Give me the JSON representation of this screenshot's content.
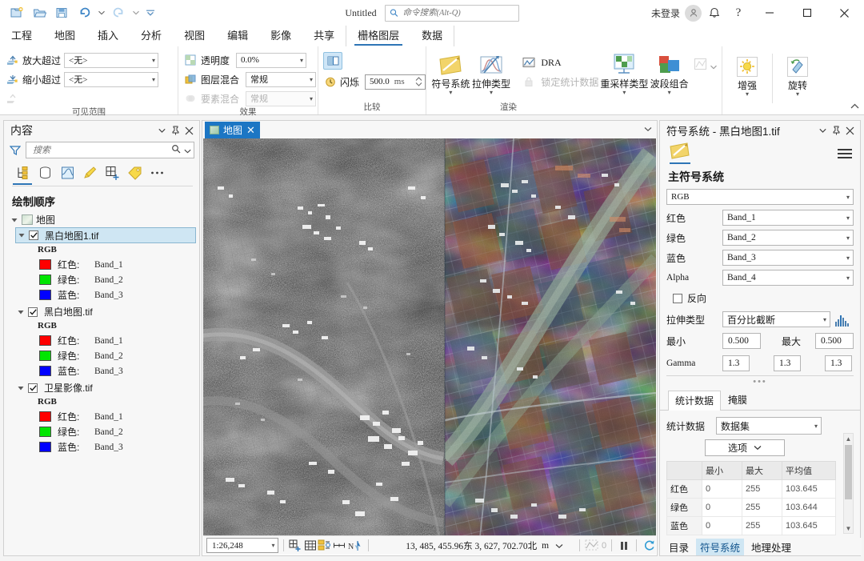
{
  "titlebar": {
    "doc_title": "Untitled",
    "search_placeholder": "命令搜索(Alt-Q)",
    "signin_label": "未登录",
    "qat": [
      {
        "name": "new-project-icon",
        "label": "新建工程"
      },
      {
        "name": "open-project-icon",
        "label": "打开工程"
      },
      {
        "name": "save-project-icon",
        "label": "保存工程"
      },
      {
        "name": "undo-icon",
        "label": "撤销"
      },
      {
        "name": "redo-icon",
        "label": "重做"
      },
      {
        "name": "customize-qat-icon",
        "label": "自定义快速访问工具栏"
      }
    ],
    "window_controls": [
      "minimize",
      "maximize",
      "close"
    ],
    "help_label": "?"
  },
  "ribbon_tabs": {
    "items": [
      "工程",
      "地图",
      "插入",
      "分析",
      "视图",
      "编辑",
      "影像",
      "共享"
    ],
    "contextual": [
      "栅格图层",
      "数据"
    ],
    "active": "栅格图层"
  },
  "ribbon": {
    "groups": [
      {
        "title": "可见范围",
        "rows": [
          {
            "label": "放大超过",
            "icon": "zoom-in-beyond-icon",
            "value": "<无>"
          },
          {
            "label": "缩小超过",
            "icon": "zoom-out-beyond-icon",
            "value": "<无>"
          },
          {
            "label": "",
            "icon": "visible-range-disabled-icon",
            "value": ""
          }
        ]
      },
      {
        "title": "效果",
        "rows": [
          {
            "label": "透明度",
            "icon": "transparency-icon",
            "value": "0.0%"
          },
          {
            "label": "图层混合",
            "icon": "layer-blend-icon",
            "value": "常规"
          },
          {
            "label": "要素混合",
            "icon": "feature-blend-icon",
            "value": "常规",
            "disabled": true
          }
        ]
      },
      {
        "title": "比较",
        "swipe_icon": "swipe-icon",
        "flicker_icon": "flicker-clock-icon",
        "flicker_label": "闪烁",
        "flicker_value": "500.0",
        "flicker_unit": "ms"
      },
      {
        "title": "渲染",
        "buttons": [
          {
            "label": "符号系统",
            "icon": "symbology-icon",
            "dropdown": true
          },
          {
            "label": "拉伸类型",
            "icon": "stretch-type-icon",
            "dropdown": true
          }
        ],
        "small_items": [
          {
            "label": "DRA",
            "icon": "dra-icon",
            "disabled": false
          },
          {
            "label": "锁定统计数据",
            "icon": "lock-statistics-icon",
            "disabled": true
          }
        ],
        "buttons2": [
          {
            "label": "重采样类型",
            "icon": "resample-type-icon",
            "dropdown": true
          },
          {
            "label": "波段组合",
            "icon": "band-combination-icon",
            "dropdown": true
          }
        ],
        "extra_icon": {
          "label": "",
          "icon": "raster-function-icon",
          "disabled": true,
          "dropdown": true
        }
      },
      {
        "title": "",
        "buttons": [
          {
            "label": "增强",
            "icon": "enhance-sun-icon",
            "dropdown": true
          },
          {
            "label": "旋转",
            "icon": "rotate-icon",
            "dropdown": true
          }
        ]
      }
    ],
    "collapse_icon": "chevron-up-icon"
  },
  "contents": {
    "title": "内容",
    "search_placeholder": "搜索",
    "tools": [
      {
        "name": "list-by-drawing-order-icon",
        "selected": true
      },
      {
        "name": "list-by-data-source-icon",
        "selected": false
      },
      {
        "name": "list-by-selection-icon",
        "selected": false
      },
      {
        "name": "list-by-editing-icon",
        "selected": false
      },
      {
        "name": "list-by-snapping-icon",
        "selected": false
      },
      {
        "name": "list-by-labeling-icon",
        "selected": false
      },
      {
        "name": "more-options-icon",
        "selected": false
      }
    ],
    "section_title": "绘制顺序",
    "map_node": "地图",
    "layers": [
      {
        "name": "黑白地图1.tif",
        "checked": true,
        "selected": true,
        "rgb_label": "RGB",
        "bands": [
          {
            "channel": "红色:",
            "band": "Band_1",
            "color": "#ff0000"
          },
          {
            "channel": "绿色:",
            "band": "Band_2",
            "color": "#00e500"
          },
          {
            "channel": "蓝色:",
            "band": "Band_3",
            "color": "#0000ff"
          }
        ]
      },
      {
        "name": "黑白地图.tif",
        "checked": true,
        "selected": false,
        "rgb_label": "RGB",
        "bands": [
          {
            "channel": "红色:",
            "band": "Band_1",
            "color": "#ff0000"
          },
          {
            "channel": "绿色:",
            "band": "Band_2",
            "color": "#00e500"
          },
          {
            "channel": "蓝色:",
            "band": "Band_3",
            "color": "#0000ff"
          }
        ]
      },
      {
        "name": "卫星影像.tif",
        "checked": true,
        "selected": false,
        "rgb_label": "RGB",
        "bands": [
          {
            "channel": "红色:",
            "band": "Band_1",
            "color": "#ff0000"
          },
          {
            "channel": "绿色:",
            "band": "Band_2",
            "color": "#00e500"
          },
          {
            "channel": "蓝色:",
            "band": "Band_3",
            "color": "#0000ff"
          }
        ]
      }
    ]
  },
  "mapview": {
    "tab_label": "地图",
    "status": {
      "scale": "1:26,248",
      "coords": "13, 485, 455.96东  3, 627, 702.70北",
      "unit": "m",
      "selection_count": "0"
    }
  },
  "symbology": {
    "title": "符号系统 - 黑白地图1.tif",
    "section_title": "主符号系统",
    "primary_value": "RGB",
    "channels": [
      {
        "label": "红色",
        "value": "Band_1"
      },
      {
        "label": "绿色",
        "value": "Band_2"
      },
      {
        "label": "蓝色",
        "value": "Band_3"
      },
      {
        "label": "Alpha",
        "value": "Band_4"
      }
    ],
    "invert_label": "反向",
    "invert_checked": false,
    "stretch_label": "拉伸类型",
    "stretch_value": "百分比截断",
    "min_label": "最小",
    "min_value": "0.500",
    "max_label": "最大",
    "max_value": "0.500",
    "gamma_label": "Gamma",
    "gamma_values": [
      "1.3",
      "1.3",
      "1.3"
    ],
    "tabs": [
      {
        "label": "统计数据",
        "active": true
      },
      {
        "label": "掩膜",
        "active": false
      }
    ],
    "stats_label": "统计数据",
    "stats_source": "数据集",
    "options_label": "选项",
    "table": {
      "headers": [
        "",
        "最小",
        "最大",
        "平均值"
      ],
      "rows": [
        [
          "红色",
          "0",
          "255",
          "103.645"
        ],
        [
          "绿色",
          "0",
          "255",
          "103.644"
        ],
        [
          "蓝色",
          "0",
          "255",
          "103.645"
        ]
      ]
    },
    "bottom_tabs": [
      {
        "label": "目录",
        "active": false
      },
      {
        "label": "符号系统",
        "active": true
      },
      {
        "label": "地理处理",
        "active": false
      }
    ]
  },
  "colors": {
    "accent": "#2e75b6",
    "tab_active": "#1c76c4",
    "selection": "#cfe6f3"
  }
}
